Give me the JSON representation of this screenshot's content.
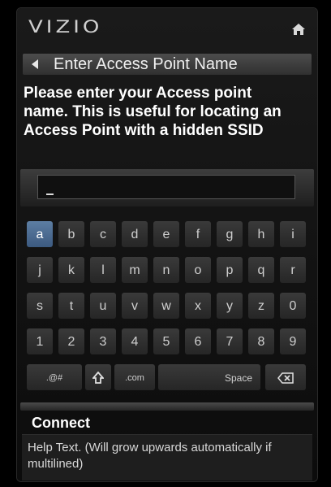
{
  "header": {
    "logo": "VIZIO",
    "home_icon": "home-icon"
  },
  "title_bar": {
    "title": "Enter Access Point Name",
    "back_icon": "back-arrow-icon"
  },
  "instructions": "Please enter your Access point name. This is useful for locating an Access Point with a hidden SSID",
  "input": {
    "value": "",
    "placeholder": ""
  },
  "keyboard": {
    "rows": [
      [
        "a",
        "b",
        "c",
        "d",
        "e",
        "f",
        "g",
        "h",
        "i"
      ],
      [
        "j",
        "k",
        "l",
        "m",
        "n",
        "o",
        "p",
        "q",
        "r"
      ],
      [
        "s",
        "t",
        "u",
        "v",
        "w",
        "x",
        "y",
        "z",
        "0"
      ],
      [
        "1",
        "2",
        "3",
        "4",
        "5",
        "6",
        "7",
        "8",
        "9"
      ]
    ],
    "bottom_row": {
      "symbols": ".@#",
      "shift_icon": "shift-icon",
      "dotcom": ".com",
      "space": "Space",
      "backspace_icon": "backspace-icon"
    },
    "selected_key": "a"
  },
  "connect_label": "Connect",
  "help_text": "Help Text. (Will grow upwards automatically if multilined)",
  "colors": {
    "background": "#000000",
    "panel": "#121212",
    "key": "#303030",
    "key_selected": "#4c6d93",
    "text": "#ffffff"
  }
}
